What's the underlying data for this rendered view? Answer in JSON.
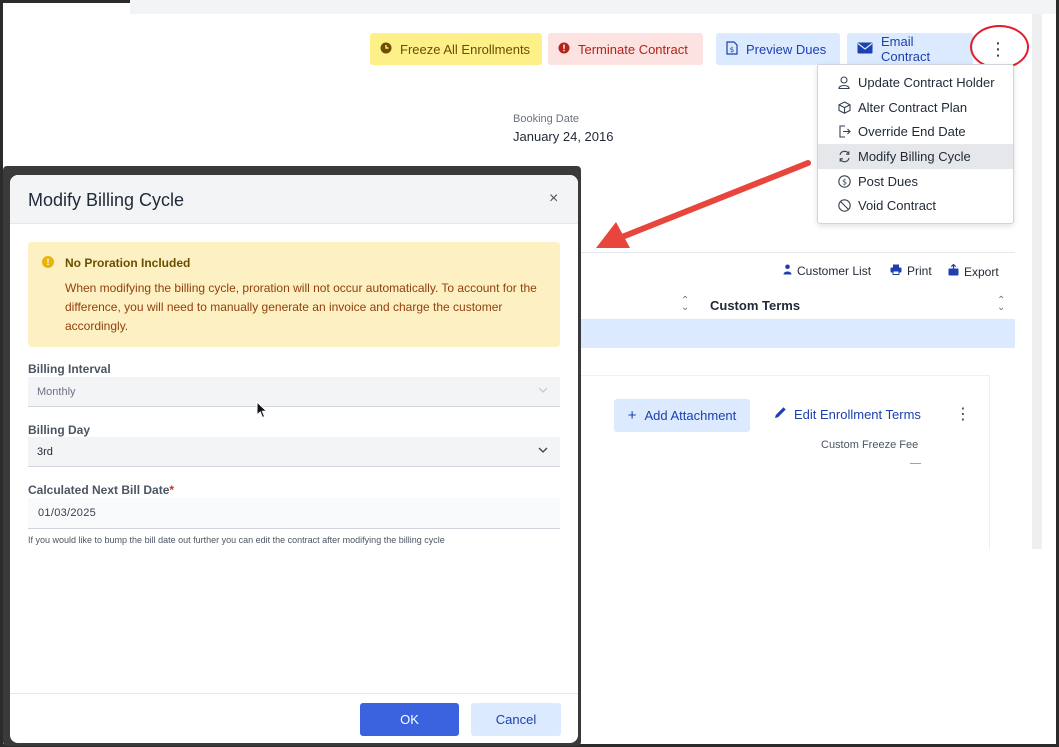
{
  "toolbar": {
    "freeze_label": "Freeze All Enrollments",
    "terminate_label": "Terminate Contract",
    "preview_label": "Preview Dues",
    "email_label": "Email Contract",
    "more_glyph": "⋮"
  },
  "menu": {
    "items": [
      {
        "label": "Update Contract Holder",
        "icon": "user-icon"
      },
      {
        "label": "Alter Contract Plan",
        "icon": "cube-icon"
      },
      {
        "label": "Override End Date",
        "icon": "exit-icon"
      },
      {
        "label": "Modify Billing Cycle",
        "icon": "cycle-icon",
        "active": true
      },
      {
        "label": "Post Dues",
        "icon": "dollar-icon"
      },
      {
        "label": "Void Contract",
        "icon": "ban-icon"
      }
    ]
  },
  "booking": {
    "label": "Booking Date",
    "value": "January 24, 2016"
  },
  "table": {
    "tools": {
      "customer_list": "Customer List",
      "print": "Print",
      "export": "Export"
    },
    "column_header": "Custom Terms"
  },
  "card": {
    "add_attachment": "Add Attachment",
    "edit_terms": "Edit Enrollment Terms",
    "freeze_fee_label": "Custom Freeze Fee",
    "freeze_fee_value": "—"
  },
  "modal": {
    "title": "Modify Billing Cycle",
    "close_glyph": "×",
    "alert": {
      "title": "No Proration Included",
      "body": "When modifying the billing cycle, proration will not occur automatically. To account for the difference, you will need to manually generate an invoice and charge the customer accordingly."
    },
    "billing_interval": {
      "label": "Billing Interval",
      "value": "Monthly"
    },
    "billing_day": {
      "label": "Billing Day",
      "value": "3rd"
    },
    "next_bill_date": {
      "label": "Calculated Next Bill Date",
      "required": "*",
      "value": "01/03/2025"
    },
    "help": "If you would like to bump the bill date out further you can edit the contract after modifying the billing cycle",
    "ok_label": "OK",
    "cancel_label": "Cancel"
  },
  "colors": {
    "accent": "#3b63e0",
    "annotation_red": "#e11d2b",
    "alert_bg": "#fdf1c3",
    "freeze_bg": "#fdf089",
    "terminate_bg": "#fde2e2",
    "info_bg": "#dbeafe"
  }
}
